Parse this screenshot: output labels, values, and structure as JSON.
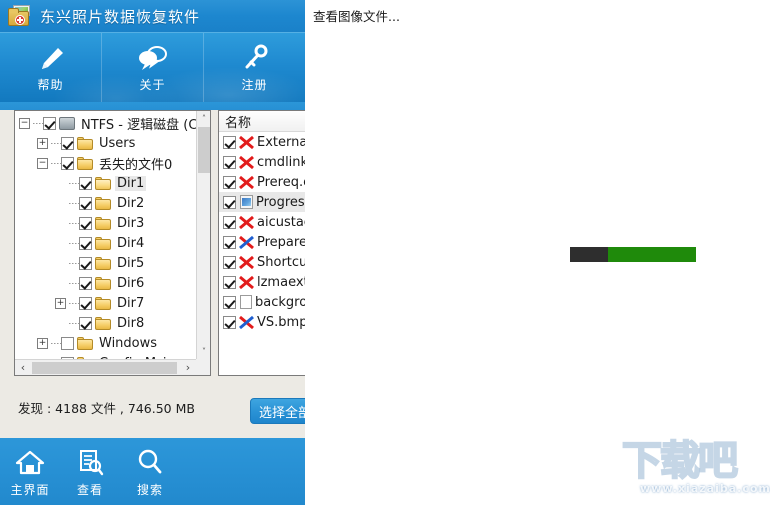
{
  "app": {
    "title": "东兴照片数据恢复软件",
    "icon": "folder-photo-recovery-icon",
    "ribbon_buttons": [
      {
        "label": "帮助",
        "icon": "pen-icon"
      },
      {
        "label": "关于",
        "icon": "speech-bubbles-icon"
      },
      {
        "label": "注册",
        "icon": "key-icon"
      }
    ],
    "bottom_buttons": [
      {
        "label": "主界面",
        "icon": "home-icon"
      },
      {
        "label": "查看",
        "icon": "document-search-icon"
      },
      {
        "label": "搜索",
        "icon": "magnifier-icon"
      }
    ],
    "status_text": "发现 : 4188 文件 , 746.50 MB",
    "select_all_label": "选择全部"
  },
  "tree": {
    "nodes": [
      {
        "label": "NTFS - 逻辑磁盘 (C:)",
        "indent": 0,
        "expander": "minus",
        "checked": true,
        "icon": "disk-icon",
        "selected": false
      },
      {
        "label": "Users",
        "indent": 1,
        "expander": "plus",
        "checked": true,
        "icon": "folder-icon",
        "selected": false
      },
      {
        "label": "丢失的文件0",
        "indent": 1,
        "expander": "minus",
        "checked": true,
        "icon": "folder-icon",
        "selected": false
      },
      {
        "label": "Dir1",
        "indent": 2,
        "expander": "none",
        "checked": true,
        "icon": "folder-open-icon",
        "selected": true
      },
      {
        "label": "Dir2",
        "indent": 2,
        "expander": "none",
        "checked": true,
        "icon": "folder-icon",
        "selected": false
      },
      {
        "label": "Dir3",
        "indent": 2,
        "expander": "none",
        "checked": true,
        "icon": "folder-icon",
        "selected": false
      },
      {
        "label": "Dir4",
        "indent": 2,
        "expander": "none",
        "checked": true,
        "icon": "folder-icon",
        "selected": false
      },
      {
        "label": "Dir5",
        "indent": 2,
        "expander": "none",
        "checked": true,
        "icon": "folder-icon",
        "selected": false
      },
      {
        "label": "Dir6",
        "indent": 2,
        "expander": "none",
        "checked": true,
        "icon": "folder-icon",
        "selected": false
      },
      {
        "label": "Dir7",
        "indent": 2,
        "expander": "plus",
        "checked": true,
        "icon": "folder-icon",
        "selected": false
      },
      {
        "label": "Dir8",
        "indent": 2,
        "expander": "none",
        "checked": true,
        "icon": "folder-icon",
        "selected": false
      },
      {
        "label": "Windows",
        "indent": 1,
        "expander": "plus",
        "checked": false,
        "icon": "folder-icon",
        "selected": false
      },
      {
        "label": "Config.Msi",
        "indent": 1,
        "expander": "none",
        "checked": false,
        "icon": "folder-icon",
        "selected": false
      }
    ],
    "vscroll_up": "˄",
    "vscroll_down": "˅",
    "hscroll_left": "‹",
    "hscroll_right": "›"
  },
  "filelist": {
    "header": "名称",
    "rows": [
      {
        "label": "ExternalUI",
        "icon": "red-cross-icon",
        "checked": true,
        "selected": false
      },
      {
        "label": "cmdlinka",
        "icon": "red-cross-icon",
        "checked": true,
        "selected": false
      },
      {
        "label": "Prereq.c",
        "icon": "red-cross-icon",
        "checked": true,
        "selected": false
      },
      {
        "label": "Progress",
        "icon": "image-file-icon",
        "checked": true,
        "selected": true
      },
      {
        "label": "aicustact",
        "icon": "red-cross-icon",
        "checked": true,
        "selected": false
      },
      {
        "label": "PrepareI",
        "icon": "blue-red-cross-icon",
        "checked": true,
        "selected": false
      },
      {
        "label": "Shortcut",
        "icon": "red-cross-icon",
        "checked": true,
        "selected": false
      },
      {
        "label": "lzmaextr",
        "icon": "red-cross-icon",
        "checked": true,
        "selected": false
      },
      {
        "label": "backgro",
        "icon": "document-icon",
        "checked": true,
        "selected": false
      },
      {
        "label": "VS.bmp",
        "icon": "blue-red-cross-icon",
        "checked": true,
        "selected": false
      }
    ]
  },
  "overlay": {
    "title": "查看图像文件...",
    "progress": {
      "percent": 70,
      "dark_color": "#2e2e2e",
      "fill_color": "#1f8a0b"
    }
  },
  "watermark": {
    "text": "下载吧",
    "url": "www.xiazaiba.com"
  },
  "colors": {
    "brand_blue": "#2790d4",
    "title_blue": "#1d87cf",
    "progress_green": "#1f8a0b",
    "panel_bg": "#eceae4"
  }
}
